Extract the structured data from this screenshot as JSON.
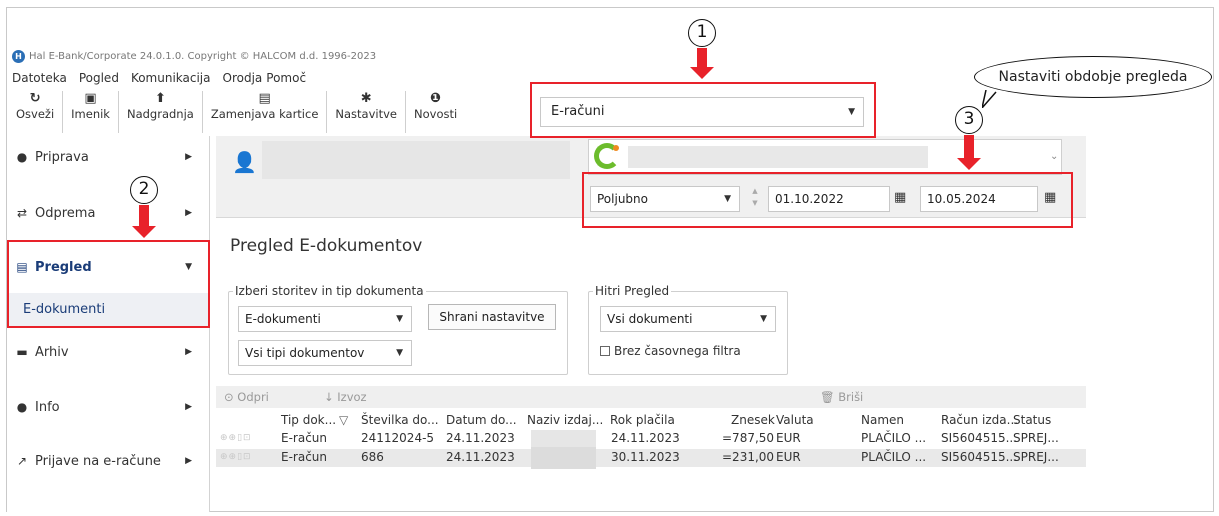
{
  "app": {
    "title": "Hal E-Bank/Corporate 24.0.1.0. Copyright © HALCOM d.d. 1996-2023"
  },
  "menu": [
    "Datoteka",
    "Pogled",
    "Komunikacija",
    "Orodja",
    "Pomoč"
  ],
  "toolbar": {
    "buttons": [
      {
        "label": "Osveži",
        "icon": "refresh-icon",
        "glyph": "↻"
      },
      {
        "label": "Imenik",
        "icon": "address-book-icon",
        "glyph": "▣"
      },
      {
        "label": "Nadgradnja",
        "icon": "upgrade-icon",
        "glyph": "⬆"
      },
      {
        "label": "Zamenjava kartice",
        "icon": "card-icon",
        "glyph": "▤"
      },
      {
        "label": "Nastavitve",
        "icon": "gear-icon",
        "glyph": "✱"
      },
      {
        "label": "Novosti",
        "icon": "info-icon",
        "glyph": "❶"
      }
    ],
    "service_select": "E-računi"
  },
  "sidebar": {
    "items": [
      {
        "label": "Priprava",
        "icon": "record-icon",
        "glyph": "●"
      },
      {
        "label": "Odprema",
        "icon": "swap-icon",
        "glyph": "⇄"
      },
      {
        "label": "Pregled",
        "icon": "clipboard-icon",
        "glyph": "▤"
      },
      {
        "label": "Arhiv",
        "icon": "archive-icon",
        "glyph": "▬"
      },
      {
        "label": "Info",
        "icon": "info-circle-icon",
        "glyph": "●"
      },
      {
        "label": "Prijave na e-račune",
        "icon": "external-link-icon",
        "glyph": "↗"
      }
    ],
    "active_subitem": "E-dokumenti"
  },
  "header": {
    "period": "Poljubno",
    "date_from": "01.10.2022",
    "date_to": "10.05.2024"
  },
  "page": {
    "title": "Pregled E-dokumentov",
    "service_group": {
      "legend": "Izberi storitev in tip dokumenta",
      "service_value": "E-dokumenti",
      "doctype_value": "Vsi tipi dokumentov",
      "save_button": "Shrani nastavitve"
    },
    "quick_group": {
      "legend": "Hitri Pregled",
      "filter_value": "Vsi dokumenti",
      "no_time_filter_label": "Brez časovnega filtra"
    }
  },
  "grid": {
    "actions": {
      "open": "⊙ Odpri",
      "export": "↓ Izvoz",
      "delete": "🗑 Briši"
    },
    "columns": [
      "Tip dok...",
      "Številka do...",
      "Datum do...",
      "Naziv izdaj...",
      "Rok plačila",
      "Znesek",
      "Valuta",
      "Namen",
      "Račun izda...",
      "Status"
    ],
    "rows": [
      [
        "E-račun",
        "24112024-5",
        "24.11.2023",
        "",
        "24.11.2023",
        "=787,50",
        "EUR",
        "PLAČILO ...",
        "SI5604515...",
        "SPREJ..."
      ],
      [
        "E-račun",
        "686",
        "24.11.2023",
        "",
        "30.11.2023",
        "=231,00",
        "EUR",
        "PLAČILO ...",
        "SI5604515...",
        "SPREJ..."
      ]
    ]
  },
  "annotations": {
    "markers": [
      "1",
      "2",
      "3"
    ],
    "callout": "Nastaviti obdobje pregleda"
  },
  "colors": {
    "highlight": "#e8222a",
    "nav_active": "#1a3c78"
  }
}
